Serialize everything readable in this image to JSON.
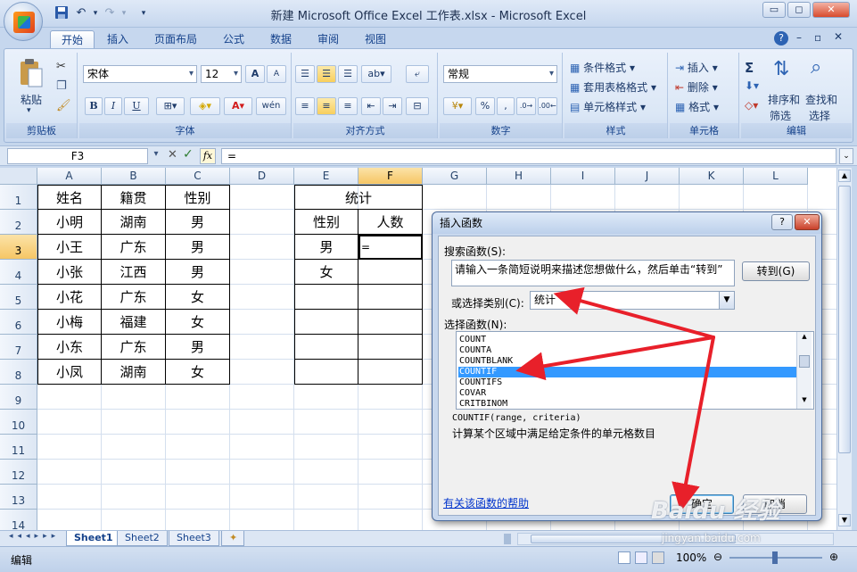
{
  "window": {
    "title": "新建 Microsoft Office Excel 工作表.xlsx - Microsoft Excel",
    "min": "▭",
    "max": "◻",
    "close": "✕"
  },
  "qat": {
    "save_icon": "save-icon",
    "undo_icon": "undo-icon",
    "redo_icon": "redo-icon",
    "dropdown": "▾"
  },
  "tabs": [
    "开始",
    "插入",
    "页面布局",
    "公式",
    "数据",
    "审阅",
    "视图"
  ],
  "ribbon": {
    "clipboard": {
      "label": "剪贴板",
      "paste": "粘贴"
    },
    "font": {
      "label": "字体",
      "name": "宋体",
      "size": "12",
      "grow": "A",
      "shrink": "A",
      "bold": "B",
      "italic": "I",
      "underline": "U",
      "wen": "wén"
    },
    "align": {
      "label": "对齐方式"
    },
    "number": {
      "label": "数字",
      "format": "常规",
      "percent": "%",
      "comma": ","
    },
    "styles": {
      "label": "样式",
      "cond": "条件格式",
      "table": "套用表格格式",
      "cell": "单元格样式"
    },
    "cells": {
      "label": "单元格",
      "insert": "插入",
      "delete": "删除",
      "format": "格式"
    },
    "edit": {
      "label": "编辑",
      "sum": "Σ",
      "sort1": "排序和",
      "sort2": "筛选",
      "find1": "查找和",
      "find2": "选择"
    }
  },
  "formula_bar": {
    "name_box": "F3",
    "fx": "fx",
    "content": "="
  },
  "columns": [
    "A",
    "B",
    "C",
    "D",
    "E",
    "F",
    "G",
    "H",
    "I",
    "J",
    "K",
    "L"
  ],
  "rows": [
    "1",
    "2",
    "3",
    "4",
    "5",
    "6",
    "7",
    "8",
    "9",
    "10",
    "11",
    "12",
    "13",
    "14"
  ],
  "table1": {
    "headers": [
      "姓名",
      "籍贯",
      "性别"
    ],
    "rows": [
      [
        "小明",
        "湖南",
        "男"
      ],
      [
        "小王",
        "广东",
        "男"
      ],
      [
        "小张",
        "江西",
        "男"
      ],
      [
        "小花",
        "广东",
        "女"
      ],
      [
        "小梅",
        "福建",
        "女"
      ],
      [
        "小东",
        "广东",
        "男"
      ],
      [
        "小凤",
        "湖南",
        "女"
      ]
    ]
  },
  "table2": {
    "title": "统计",
    "col1": "性别",
    "col2": "人数",
    "male": "男",
    "female": "女",
    "f3": "="
  },
  "sheets": [
    "Sheet1",
    "Sheet2",
    "Sheet3"
  ],
  "status": {
    "mode": "编辑",
    "zoom": "100%"
  },
  "dialog": {
    "title": "插入函数",
    "help": "?",
    "close": "✕",
    "search_label": "搜索函数(S):",
    "search_text": "请输入一条简短说明来描述您想做什么，然后单击“转到”",
    "go": "转到(G)",
    "category_label": "或选择类别(C):",
    "category": "统计",
    "func_label": "选择函数(N):",
    "functions": [
      "COUNT",
      "COUNTA",
      "COUNTBLANK",
      "COUNTIF",
      "COUNTIFS",
      "COVAR",
      "CRITBINOM"
    ],
    "selected": "COUNTIF",
    "signature": "COUNTIF(range, criteria)",
    "description": "计算某个区域中满足给定条件的单元格数目",
    "help_link": "有关该函数的帮助",
    "ok": "确定",
    "cancel": "取消"
  },
  "watermark": {
    "logo": "Baidu 经验",
    "url": "jingyan.baidu.com"
  },
  "annotation_color": "#e8202a"
}
